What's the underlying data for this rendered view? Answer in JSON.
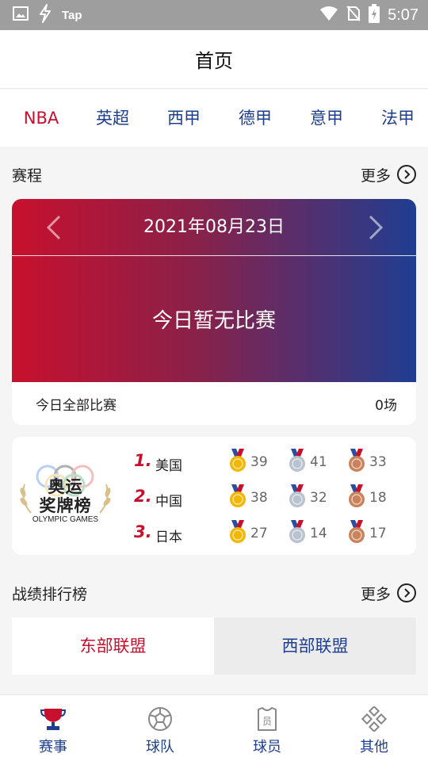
{
  "status_bar": {
    "app_label": "Tap",
    "time": "5:07"
  },
  "header": {
    "title": "首页"
  },
  "league_tabs": [
    "NBA",
    "英超",
    "西甲",
    "德甲",
    "意甲",
    "法甲"
  ],
  "schedule": {
    "section_title": "赛程",
    "more_label": "更多",
    "date": "2021年08月23日",
    "empty_message": "今日暂无比赛",
    "footer_label": "今日全部比赛",
    "footer_count": "0场"
  },
  "olympics": {
    "logo_title_line1": "奥运",
    "logo_title_line2": "奖牌榜",
    "logo_subtitle": "OLYMPIC GAMES",
    "medal_colors": {
      "gold": "#f2b705",
      "silver": "#b8c3cf",
      "bronze": "#c9825a"
    },
    "rows": [
      {
        "rank": "1.",
        "country": "美国",
        "gold": "39",
        "silver": "41",
        "bronze": "33"
      },
      {
        "rank": "2.",
        "country": "中国",
        "gold": "38",
        "silver": "32",
        "bronze": "18"
      },
      {
        "rank": "3.",
        "country": "日本",
        "gold": "27",
        "silver": "14",
        "bronze": "17"
      }
    ]
  },
  "standings": {
    "section_title": "战绩排行榜",
    "more_label": "更多",
    "tabs": [
      "东部联盟",
      "西部联盟"
    ]
  },
  "bottom_nav": [
    {
      "label": "赛事",
      "icon": "trophy-icon",
      "active": true
    },
    {
      "label": "球队",
      "icon": "ball-icon",
      "active": false
    },
    {
      "label": "球员",
      "icon": "jersey-icon",
      "active": false
    },
    {
      "label": "其他",
      "icon": "grid-dots-icon",
      "active": false
    }
  ],
  "colors": {
    "accent_red": "#c8102e",
    "accent_blue": "#1e3f8f"
  }
}
